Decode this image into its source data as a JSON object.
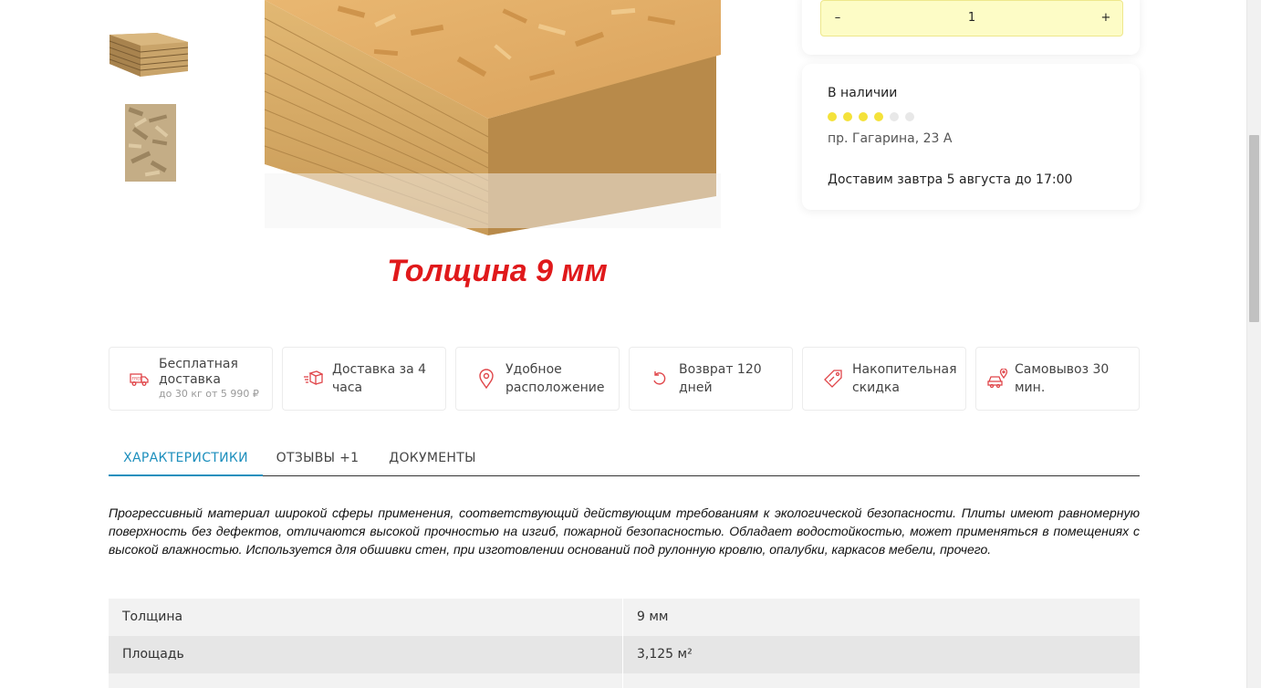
{
  "product": {
    "image_caption": "Толщина 9 мм",
    "thumbnails": [
      "osb-stack-thumb",
      "osb-texture-thumb"
    ]
  },
  "quantity": {
    "minus_label": "–",
    "value": "1",
    "plus_label": "+"
  },
  "stock": {
    "status": "В наличии",
    "rating": 4,
    "rating_max": 6,
    "address": "пр. Гагарина, 23 А",
    "delivery": "Доставим завтра 5 августа до 17:00"
  },
  "benefits": [
    {
      "icon": "truck-free-icon",
      "title": "Бесплатная доставка",
      "subtitle": "до 30 кг от 5 990 ₽"
    },
    {
      "icon": "box-fast-icon",
      "title": "Доставка за 4 часа"
    },
    {
      "icon": "location-pin-icon",
      "title": "Удобное расположение"
    },
    {
      "icon": "return-arrow-icon",
      "title": "Возврат 120 дней"
    },
    {
      "icon": "discount-tag-icon",
      "title": "Накопительная скидка"
    },
    {
      "icon": "car-pickup-icon",
      "title": "Самовывоз 30 мин."
    }
  ],
  "tabs": [
    {
      "label": "ХАРАКТЕРИСТИКИ",
      "active": true
    },
    {
      "label": "ОТЗЫВЫ +1",
      "active": false
    },
    {
      "label": "ДОКУМЕНТЫ",
      "active": false
    }
  ],
  "description": "Прогрессивный материал широкой сферы применения, соответствующий действующим требованиям к экологической безопасности. Плиты имеют равномерную поверхность без дефектов, отличаются высокой прочностью на изгиб, пожарной безопасностью. Обладает водостойкостью, может применяться в помещениях с высокой влажностью. Используется для обшивки стен, при изготовлении оснований под рулонную кровлю, опалубки, каркасов мебели, прочего.",
  "specs": [
    {
      "name": "Толщина",
      "value": "9 мм"
    },
    {
      "name": "Площадь",
      "value": "3,125 м²"
    },
    {
      "name": "",
      "value": ""
    }
  ],
  "colors": {
    "accent": "#1d8fbd",
    "icon_red": "#e0464a",
    "qty_bg": "#fdfcc6",
    "rating_on": "#f4e23a",
    "rating_off": "#e8e8e8",
    "caption_red": "#e0191b"
  }
}
